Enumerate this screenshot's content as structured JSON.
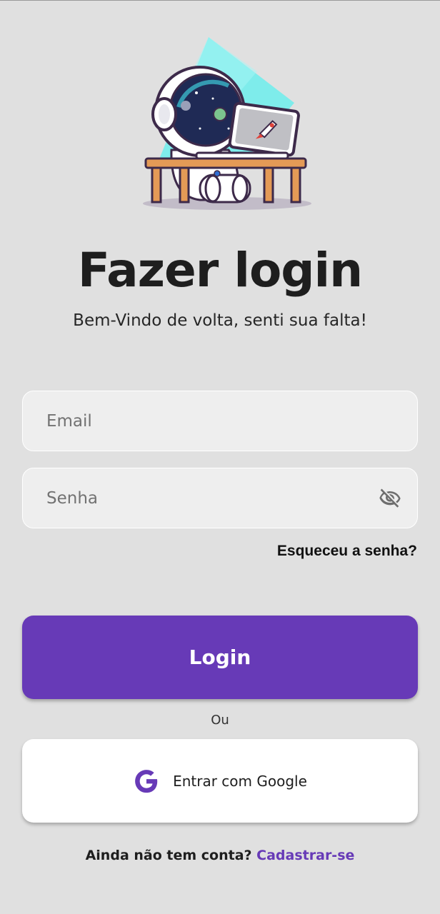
{
  "header": {
    "title": "Fazer login",
    "subtitle": "Bem-Vindo de volta, senti sua falta!"
  },
  "form": {
    "email_placeholder": "Email",
    "email_value": "",
    "password_placeholder": "Senha",
    "password_value": "",
    "password_visibility_icon": "eye-off-icon",
    "forgot_label": "Esqueceu a senha?"
  },
  "actions": {
    "login_label": "Login",
    "or_label": "Ou",
    "google_label": "Entrar com Google",
    "google_icon": "google-icon"
  },
  "footer": {
    "prompt": "Ainda não tem conta?",
    "link": "Cadastrar-se"
  },
  "colors": {
    "background": "#e0e0e0",
    "accent": "#673ab7",
    "field_background": "#eeeeee",
    "button_white": "#ffffff"
  }
}
